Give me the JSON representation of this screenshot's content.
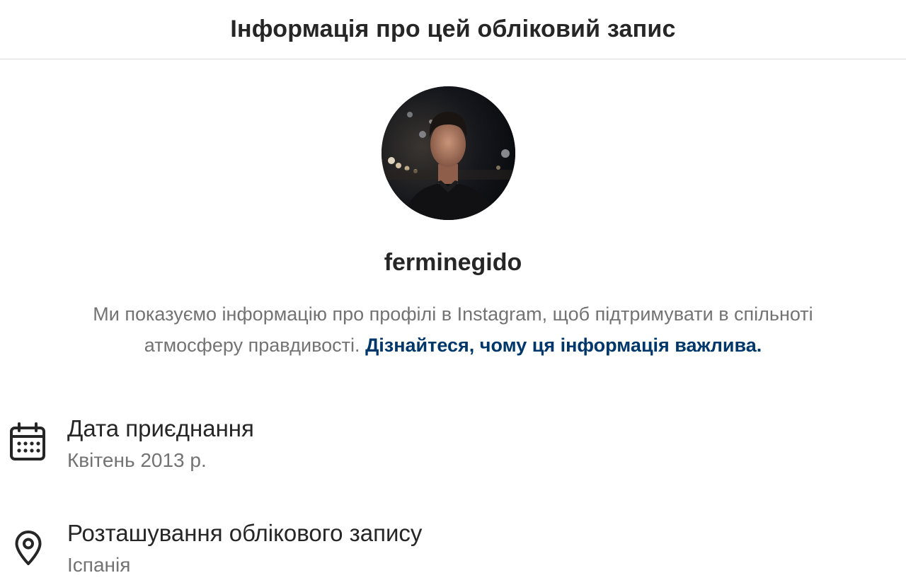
{
  "header": {
    "title": "Інформація про цей обліковий запис"
  },
  "profile": {
    "username": "ferminegido",
    "avatar_icon": "profile-photo"
  },
  "notice": {
    "text": "Ми показуємо інформацію про профілі в Instagram, щоб підтримувати в спільноті атмосферу правдивості.",
    "link_text": "Дізнайтеся, чому ця інформація важлива."
  },
  "details": {
    "join_date": {
      "icon": "calendar-icon",
      "label": "Дата приєднання",
      "value": "Квітень 2013 р."
    },
    "location": {
      "icon": "location-pin-icon",
      "label": "Розташування облікового запису",
      "value": "Іспанія"
    }
  },
  "colors": {
    "primary_text": "#262626",
    "secondary_text": "#737373",
    "link": "#00376b",
    "divider": "#dbdbdb"
  }
}
